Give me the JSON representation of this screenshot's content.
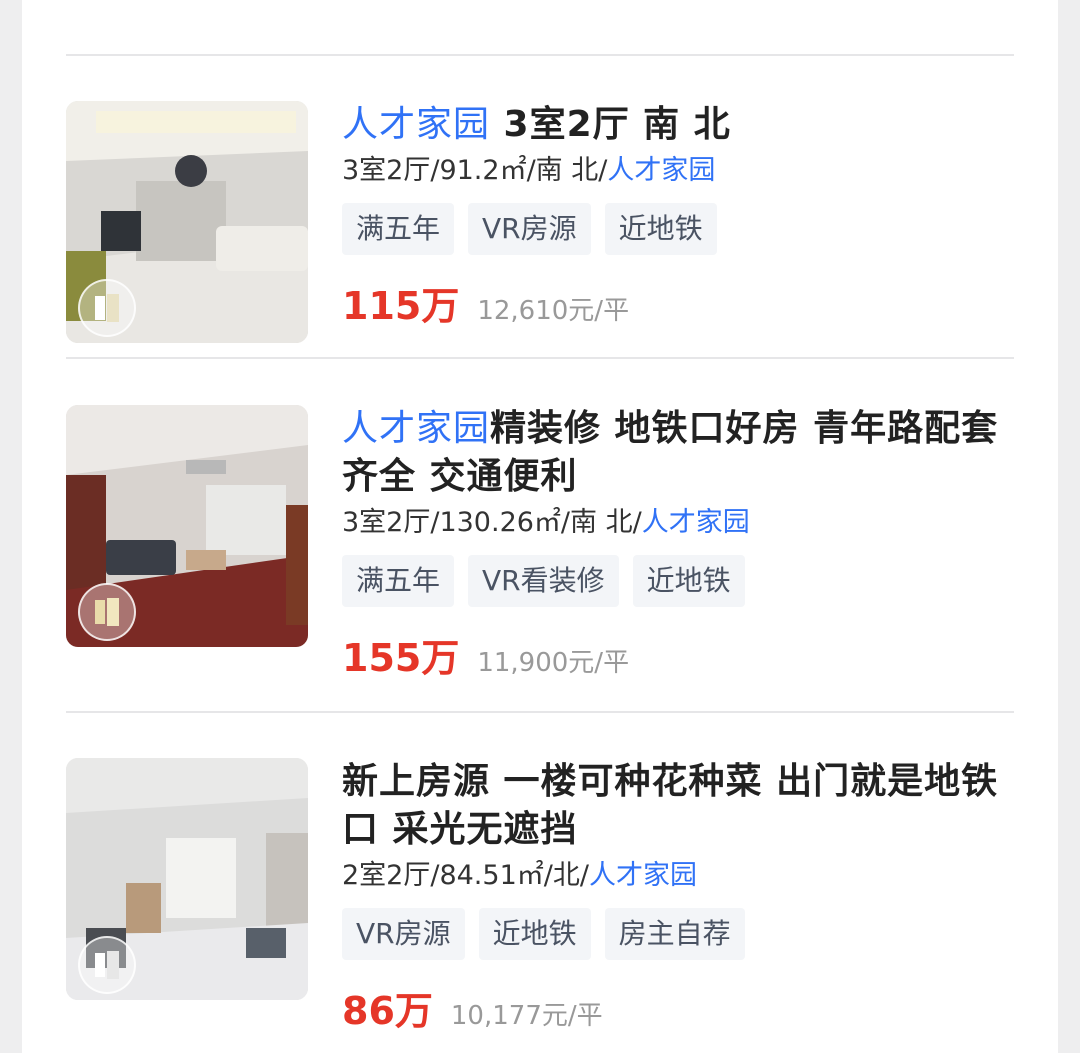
{
  "listings": [
    {
      "title_community": "人才家园",
      "title_rest": " 3室2厅 南 北",
      "meta_prefix": "3室2厅/91.2㎡/南 北/",
      "meta_community": "人才家园",
      "tags": [
        "满五年",
        "VR房源",
        "近地铁"
      ],
      "price": "115万",
      "unit_price": "12,610元/平"
    },
    {
      "title_community": "人才家园",
      "title_rest": "精装修 地铁口好房 青年路配套齐全 交通便利",
      "meta_prefix": "3室2厅/130.26㎡/南 北/",
      "meta_community": "人才家园",
      "tags": [
        "满五年",
        "VR看装修",
        "近地铁"
      ],
      "price": "155万",
      "unit_price": "11,900元/平"
    },
    {
      "title_community": "",
      "title_rest": "新上房源 一楼可种花种菜 出门就是地铁口 采光无遮挡",
      "meta_prefix": "2室2厅/84.51㎡/北/",
      "meta_community": "人才家园",
      "tags": [
        "VR房源",
        "近地铁",
        "房主自荐"
      ],
      "price": "86万",
      "unit_price": "10,177元/平"
    }
  ],
  "colors": {
    "accent": "#3072f6",
    "price": "#e53628",
    "tag_bg": "#f3f5f8"
  },
  "icons": {
    "vr_badge": "vr-panorama-icon"
  }
}
